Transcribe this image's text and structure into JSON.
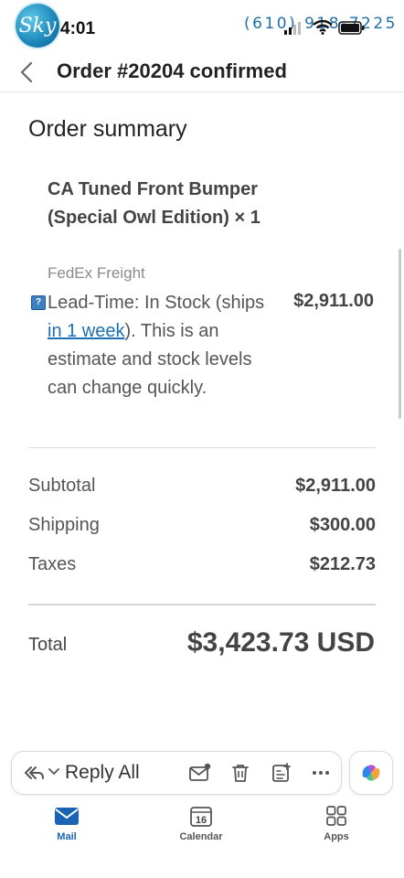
{
  "status_bar": {
    "logo_text": "Sky",
    "time": "4:01",
    "phone_number": "(610) 918-7225"
  },
  "header": {
    "title": "Order #20204 confirmed"
  },
  "order": {
    "heading": "Order summary",
    "product_name": "CA Tuned Front Bumper (Special Owl Edition) × 1",
    "shipping_method": "FedEx Freight",
    "lead_time_prefix": "Lead-Time: In Stock (ships ",
    "lead_time_link": "in 1 week",
    "lead_time_suffix": "). This is an estimate and stock levels can change quickly.",
    "item_price": "$2,911.00",
    "subtotal_label": "Subtotal",
    "subtotal_value": "$2,911.00",
    "shipping_label": "Shipping",
    "shipping_value": "$300.00",
    "taxes_label": "Taxes",
    "taxes_value": "$212.73",
    "total_label": "Total",
    "total_value": "$3,423.73 USD"
  },
  "action_bar": {
    "reply_all_label": "Reply All",
    "icons": [
      "reply-all-icon",
      "chevron-down-icon",
      "mark-unread-icon",
      "trash-icon",
      "add-task-icon",
      "more-icon",
      "copilot-icon"
    ]
  },
  "tabs": [
    {
      "label": "Mail",
      "icon": "mail-icon",
      "active": true
    },
    {
      "label": "Calendar",
      "icon": "calendar-icon",
      "active": false,
      "date": "16"
    },
    {
      "label": "Apps",
      "icon": "apps-icon",
      "active": false
    }
  ],
  "colors": {
    "accent": "#1b63b5",
    "link": "#1d6fb3",
    "phone_text": "#1e6fa8"
  }
}
